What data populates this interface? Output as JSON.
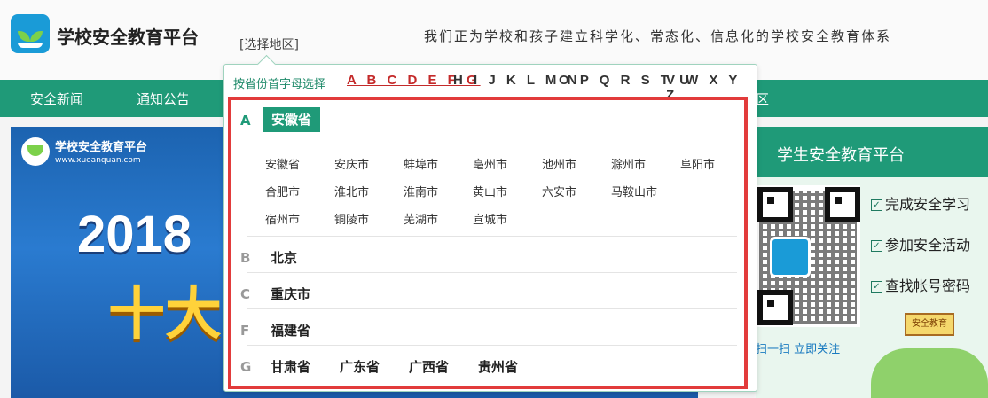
{
  "header": {
    "site_title": "学校安全教育平台",
    "region_link": "[选择地区]",
    "slogan": "我们正为学校和孩子建立科学化、常态化、信息化的学校安全教育体系"
  },
  "nav": {
    "items": [
      "安全新闻",
      "通知公告"
    ],
    "edge_label": "区"
  },
  "banner": {
    "site_name": "学校安全教育平台",
    "url": "www.xueanquan.com",
    "year": "2018",
    "headline": "十大"
  },
  "side": {
    "title": "学生安全教育平台",
    "links": [
      "完成安全学习",
      "参加安全活动",
      "查找帐号密码"
    ],
    "scan_text": "扫一扫  立即关注",
    "sign_text": "安全教育"
  },
  "popup": {
    "hint": "按省份首字母选择",
    "letter_groups": [
      "A B C D E F G",
      "H I J K L M N",
      "O P Q R S T U",
      "V W X Y Z"
    ],
    "active_group": 0,
    "sections": [
      {
        "letter": "A",
        "selected": "安徽省",
        "cities": [
          [
            "安徽省",
            "安庆市",
            "蚌埠市",
            "亳州市",
            "池州市",
            "滁州市",
            "阜阳市"
          ],
          [
            "合肥市",
            "淮北市",
            "淮南市",
            "黄山市",
            "六安市",
            "马鞍山市"
          ],
          [
            "宿州市",
            "铜陵市",
            "芜湖市",
            "宣城市"
          ]
        ]
      },
      {
        "letter": "B",
        "provinces": [
          "北京"
        ]
      },
      {
        "letter": "C",
        "provinces": [
          "重庆市"
        ]
      },
      {
        "letter": "F",
        "provinces": [
          "福建省"
        ]
      },
      {
        "letter": "G",
        "provinces": [
          "甘肃省",
          "广东省",
          "广西省",
          "贵州省"
        ]
      }
    ]
  },
  "colors": {
    "primary_green": "#1f9a78",
    "highlight_red": "#e23b3b",
    "active_letter": "#c42a2a"
  }
}
